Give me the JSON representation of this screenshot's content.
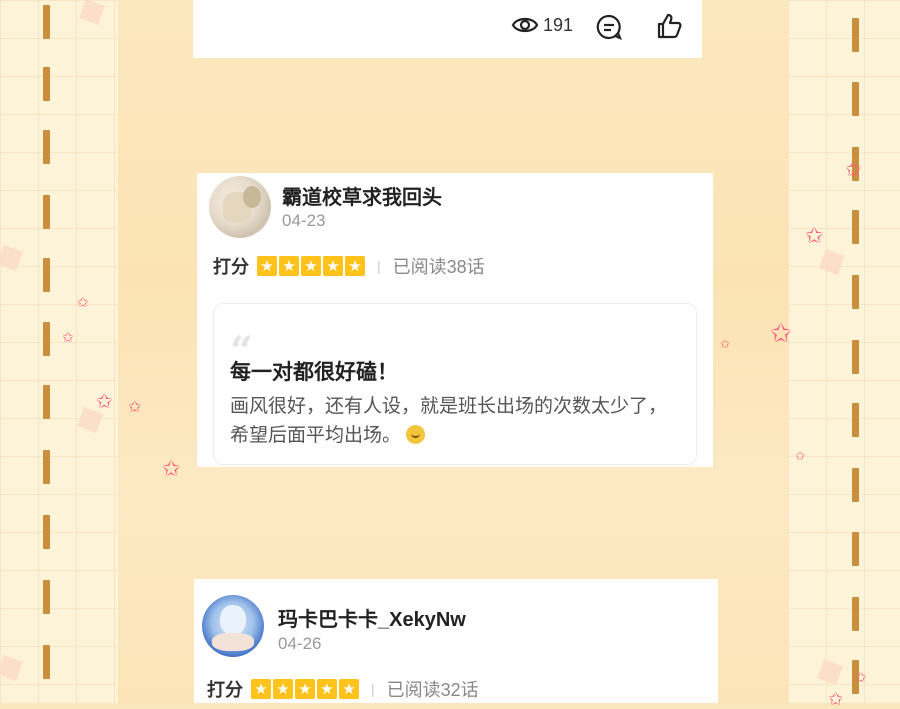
{
  "colors": {
    "star": "#ffc21a",
    "dash": "#c98f3d",
    "sparkle": "#ff5d7a"
  },
  "top_card": {
    "views": "191",
    "icons": [
      "eye-icon",
      "comment-icon",
      "thumbs-up-icon"
    ]
  },
  "reviews": [
    {
      "username": "霸道校草求我回头",
      "date": "04-23",
      "rating_label": "打分",
      "stars": 5,
      "separator": "|",
      "read_progress": "已阅读38话",
      "title": "每一对都很好磕！",
      "body": "画风很好，还有人设，就是班长出场的次数太少了，希望后面平均出场。",
      "body_emoji": "smile-emoji"
    },
    {
      "username": "玛卡巴卡卡_XekyNw",
      "date": "04-26",
      "rating_label": "打分",
      "stars": 5,
      "separator": "|",
      "read_progress": "已阅读32话"
    }
  ]
}
